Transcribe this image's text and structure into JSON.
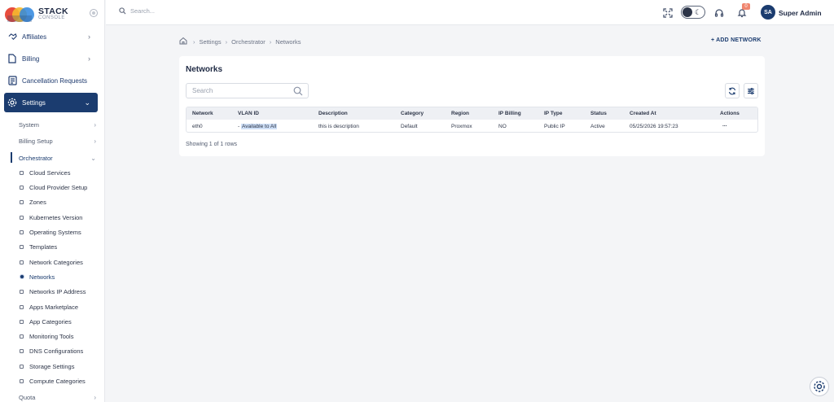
{
  "brand": {
    "name": "STACK",
    "sub": "CONSOLE"
  },
  "search": {
    "placeholder": "Search..."
  },
  "user": {
    "initials": "SA",
    "name": "Super Admin",
    "notifications": "0"
  },
  "sidebar": {
    "top_items": [
      {
        "label": "Affiliates",
        "icon": "handshake-icon"
      },
      {
        "label": "Billing",
        "icon": "document-icon"
      },
      {
        "label": "Cancellation Requests",
        "icon": "list-icon"
      },
      {
        "label": "Settings",
        "icon": "gear-icon"
      }
    ],
    "settings_children": [
      "System",
      "Billing Setup",
      "Orchestrator"
    ],
    "orchestrator_children": [
      "Cloud Services",
      "Cloud Provider Setup",
      "Zones",
      "Kubernetes Version",
      "Operating Systems",
      "Templates",
      "Network Categories",
      "Networks",
      "Networks IP Address",
      "Apps Marketplace",
      "App Categories",
      "Monitoring Tools",
      "DNS Configurations",
      "Storage Settings",
      "Compute Categories"
    ],
    "bottom_item": "Quota"
  },
  "breadcrumb": [
    "Settings",
    "Orchestrator",
    "Networks"
  ],
  "actions": {
    "add_network": "+ ADD NETWORK"
  },
  "card": {
    "title": "Networks",
    "search_placeholder": "Search",
    "columns": [
      "Network",
      "VLAN ID",
      "Description",
      "Category",
      "Region",
      "IP Billing",
      "IP Type",
      "Status",
      "Created At",
      "Actions"
    ],
    "rows": [
      {
        "network": "eth0",
        "vlan_dash": "-",
        "vlan_label": "Available to All",
        "description": "this is description",
        "category": "Default",
        "region": "Proxmox",
        "ip_billing": "NO",
        "ip_type": "Public IP",
        "status": "Active",
        "created_at": "05/25/2026 19:57:23",
        "actions": "..."
      }
    ],
    "rows_info": "Showing 1 of 1 rows"
  }
}
